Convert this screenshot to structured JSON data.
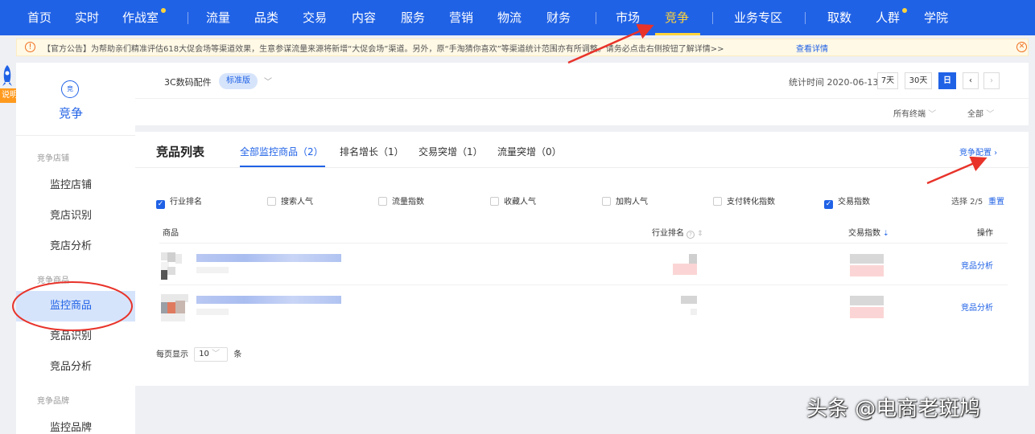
{
  "topnav": {
    "items": [
      {
        "label": "首页",
        "dot": false
      },
      {
        "label": "实时",
        "dot": false
      },
      {
        "label": "作战室",
        "dot": true
      },
      {
        "label": "流量",
        "dot": false
      },
      {
        "label": "品类",
        "dot": false
      },
      {
        "label": "交易",
        "dot": false
      },
      {
        "label": "内容",
        "dot": false
      },
      {
        "label": "服务",
        "dot": false
      },
      {
        "label": "营销",
        "dot": false
      },
      {
        "label": "物流",
        "dot": false
      },
      {
        "label": "财务",
        "dot": false
      },
      {
        "label": "市场",
        "dot": false
      },
      {
        "label": "竞争",
        "dot": false,
        "active": true
      },
      {
        "label": "业务专区",
        "dot": false
      },
      {
        "label": "取数",
        "dot": false
      },
      {
        "label": "人群",
        "dot": true
      },
      {
        "label": "学院",
        "dot": false
      }
    ],
    "background": "#2062e6",
    "active_color": "#ffd43b"
  },
  "notice": {
    "icon": "warning-icon",
    "text": "【官方公告】为帮助亲们精准评估618大促会场等渠道效果，生意参谋流量来源将新增“大促会场”渠道。另外，原“手淘猜你喜欢”等渠道统计范围亦有所调整。请务必点击右侧按钮了解详情>>",
    "link": "查看详情"
  },
  "guide": {
    "label": "说明"
  },
  "sidebar": {
    "logo_text": "竞",
    "title": "竞争",
    "groups": [
      {
        "label": "竞争店铺",
        "items": [
          "监控店铺",
          "竞店识别",
          "竞店分析"
        ]
      },
      {
        "label": "竞争商品",
        "items": [
          "监控商品",
          "竞品识别",
          "竞品分析"
        ]
      },
      {
        "label": "竞争品牌",
        "items": [
          "监控品牌"
        ]
      }
    ],
    "active_item": "监控商品"
  },
  "header": {
    "category": "3C数码配件",
    "edition": "标准版",
    "stat_time_label": "统计时间 2020-06-13",
    "periods": [
      "7天",
      "30天",
      "日"
    ],
    "active_period": "日",
    "prev": "‹",
    "next": "›",
    "terminal": "所有终端",
    "scope": "全部"
  },
  "product_list": {
    "title": "竞品列表",
    "tabs": [
      "全部监控商品（2）",
      "排名增长（1）",
      "交易突增（1）",
      "流量突增（0）"
    ],
    "active_tab": 0,
    "config_link": "竞争配置 ›",
    "metrics": [
      {
        "label": "行业排名",
        "checked": true
      },
      {
        "label": "搜索人气",
        "checked": false
      },
      {
        "label": "流量指数",
        "checked": false
      },
      {
        "label": "收藏人气",
        "checked": false
      },
      {
        "label": "加购人气",
        "checked": false
      },
      {
        "label": "支付转化指数",
        "checked": false
      },
      {
        "label": "交易指数",
        "checked": true
      }
    ],
    "select_count": "选择 2/5",
    "reset": "重置",
    "columns": {
      "product": "商品",
      "rank": "行业排名",
      "index": "交易指数",
      "action": "操作"
    },
    "rows": [
      {
        "action": "竞品分析"
      },
      {
        "action": "竞品分析"
      }
    ],
    "page_size_prefix": "每页显示",
    "page_size": "10",
    "page_size_suffix": "条"
  },
  "watermark": "头条 @电商老斑鸠"
}
